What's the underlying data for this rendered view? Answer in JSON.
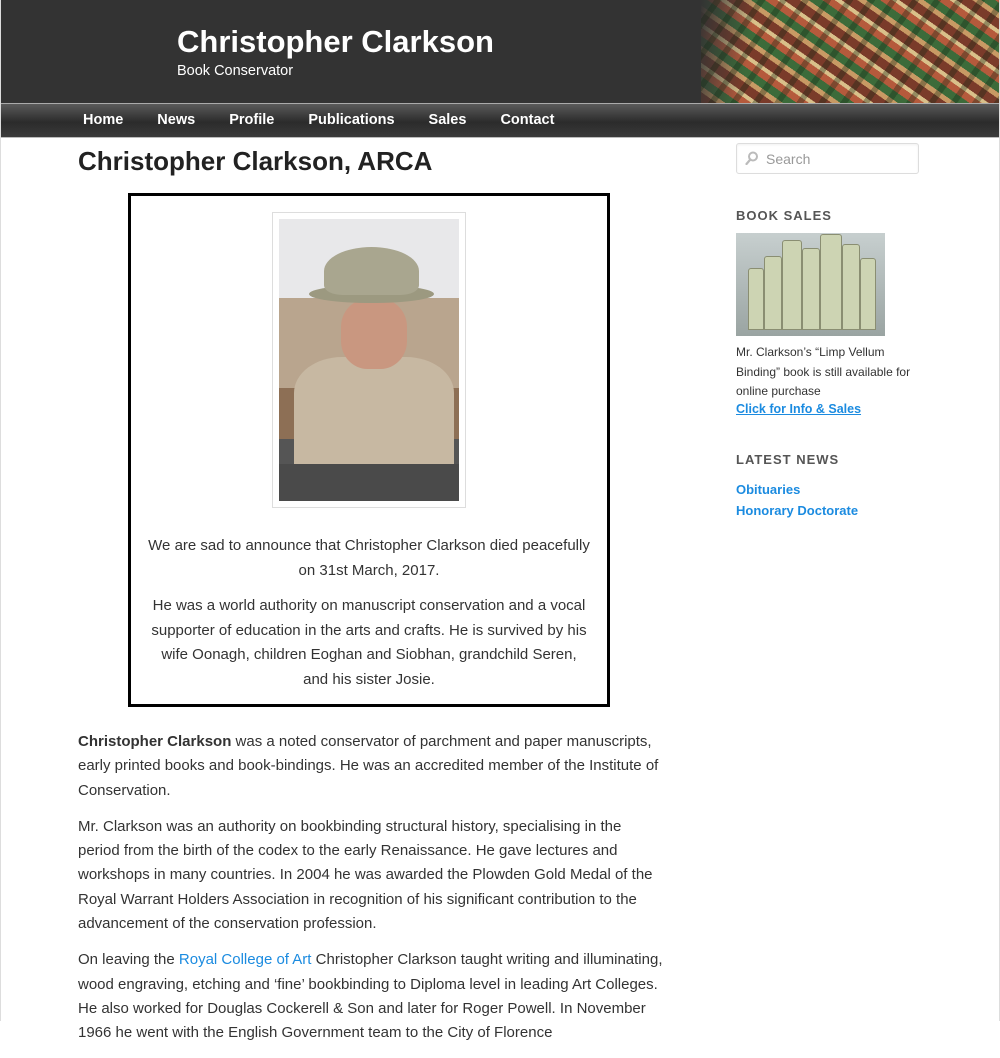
{
  "site": {
    "title": "Christopher Clarkson",
    "tagline": "Book Conservator"
  },
  "nav": {
    "items": [
      "Home",
      "News",
      "Profile",
      "Publications",
      "Sales",
      "Contact"
    ]
  },
  "main": {
    "heading": "Christopher Clarkson, ARCA",
    "notice": {
      "p1": "We are sad to announce that Christopher Clarkson died peacefully on 31st March, 2017.",
      "p2": "He was a world authority on manuscript conservation and a vocal supporter of education in the arts and crafts. He is survived by his wife Oonagh, children Eoghan and Siobhan, grandchild Seren, and his sister Josie."
    },
    "para1": {
      "strong": "Christopher Clarkson",
      "rest": " was a noted conservator of parchment and paper manuscripts, early printed books and book-bindings. He was an accredited member of the Institute of Conservation."
    },
    "para2": "Mr. Clarkson was an authority on bookbinding structural history, specialising in the period from the birth of the codex to the early Renaissance. He gave lectures and workshops in many countries. In 2004 he was awarded the Plowden Gold Medal of the Royal Warrant Holders Association in recognition of his significant contribution to the advancement of the conservation profession.",
    "para3": {
      "before": "On leaving the ",
      "link": "Royal College of Art",
      "after": " Christopher Clarkson taught writing and illuminating, wood engraving, etching and ‘fine’ bookbinding to Diploma level in leading Art Colleges. He also worked for Douglas Cockerell & Son and later for Roger Powell. In November 1966 he went with the English Government team to the City of Florence"
    }
  },
  "sidebar": {
    "search_placeholder": "Search",
    "book_sales": {
      "title": "BOOK SALES",
      "text": "Mr. Clarkson’s “Limp Vellum Binding” book is still available for online purchase",
      "link": "Click for Info & Sales"
    },
    "latest_news": {
      "title": "LATEST NEWS",
      "items": [
        "Obituaries",
        "Honorary Doctorate"
      ]
    }
  },
  "colors": {
    "header_bg": "#333333",
    "link": "#1b8be0"
  }
}
